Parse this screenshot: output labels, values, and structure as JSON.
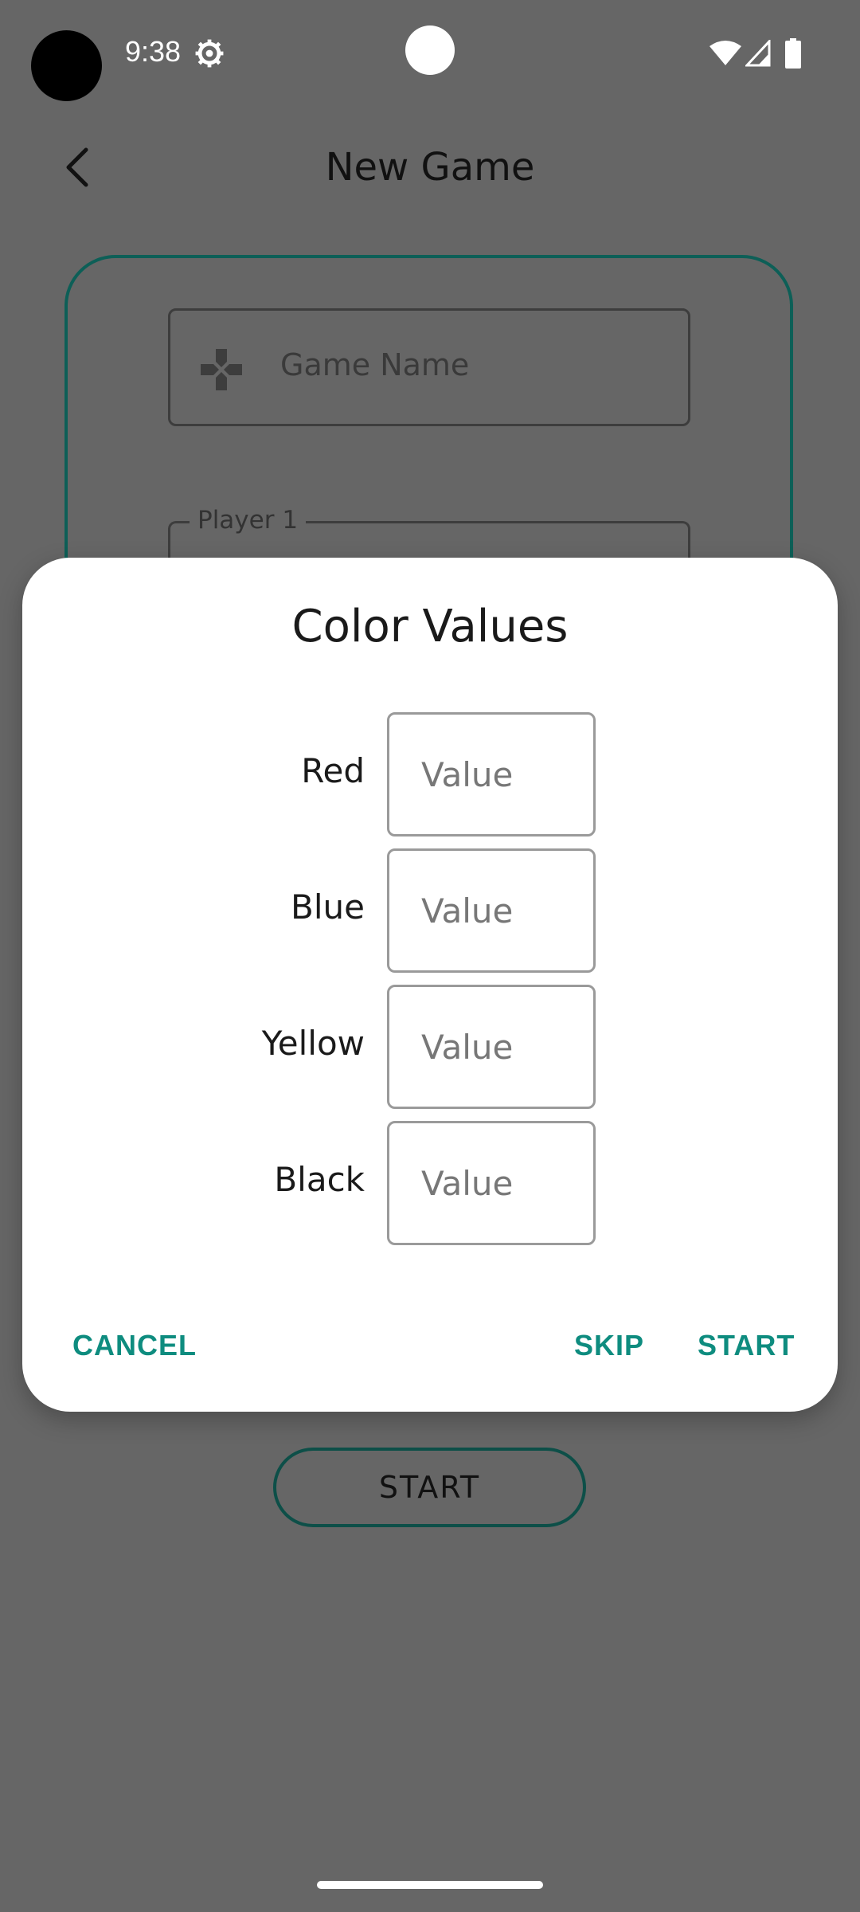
{
  "status_bar": {
    "time": "9:38",
    "icons": [
      "gear-icon",
      "wifi-icon",
      "signal-icon",
      "battery-icon"
    ]
  },
  "app_bar": {
    "title": "New Game",
    "back_icon": "back-icon"
  },
  "form": {
    "game_name_placeholder": "Game Name",
    "game_name_icon": "dpad-icon",
    "player_1_label": "Player 1",
    "start_label": "START"
  },
  "dialog": {
    "title": "Color Values",
    "rows": [
      {
        "label": "Red",
        "placeholder": "Value"
      },
      {
        "label": "Blue",
        "placeholder": "Value"
      },
      {
        "label": "Yellow",
        "placeholder": "Value"
      },
      {
        "label": "Black",
        "placeholder": "Value"
      }
    ],
    "buttons": {
      "cancel": "CANCEL",
      "skip": "SKIP",
      "start": "START"
    }
  },
  "colors": {
    "scrim": "#666666",
    "accent": "#0e8c7f",
    "card_border": "#0d5f57"
  }
}
